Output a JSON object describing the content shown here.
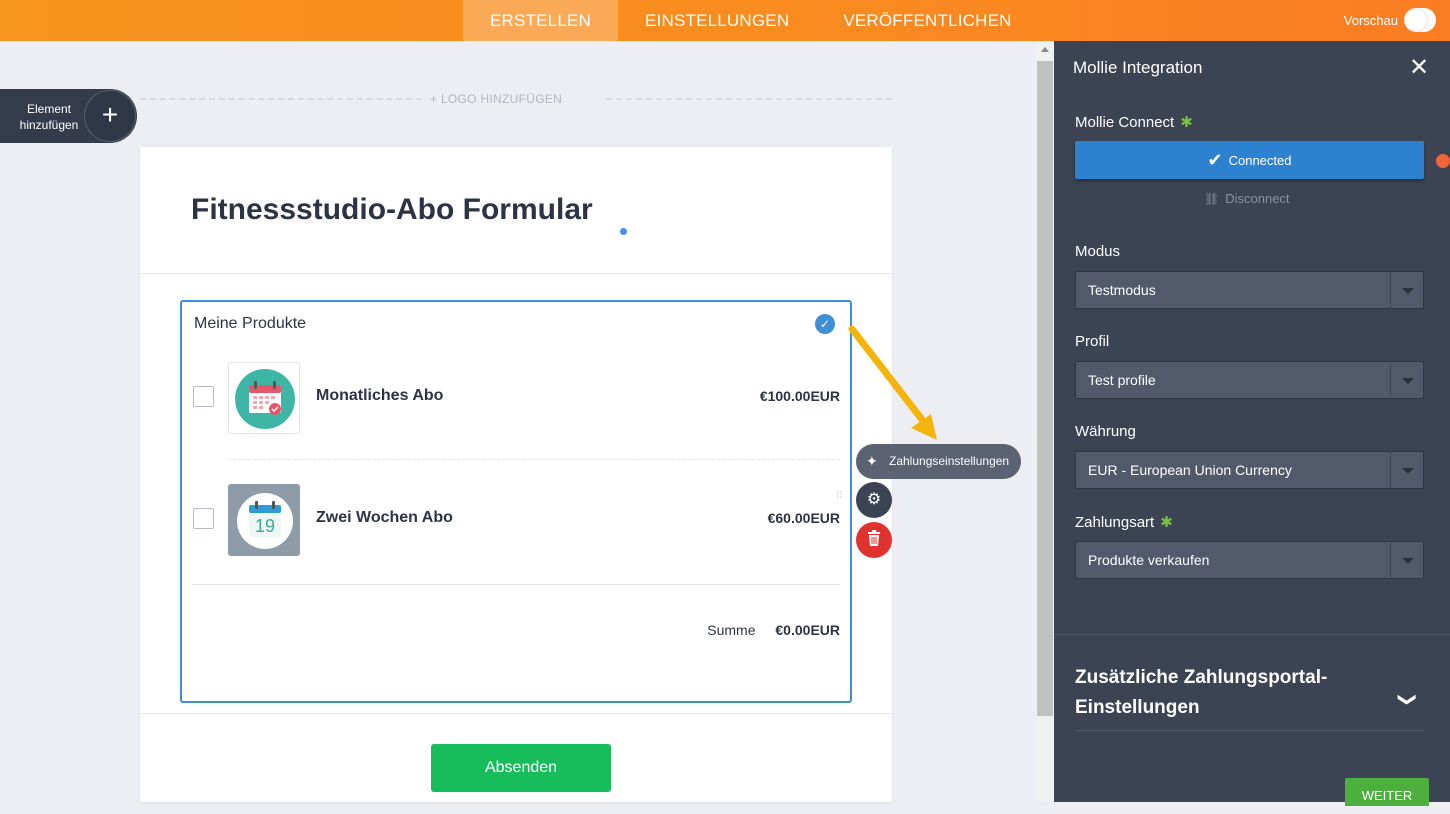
{
  "topbar": {
    "tabs": [
      {
        "label": "ERSTELLEN",
        "active": true
      },
      {
        "label": "EINSTELLUNGEN",
        "active": false
      },
      {
        "label": "VERÖFFENTLICHEN",
        "active": false
      }
    ],
    "preview_label": "Vorschau"
  },
  "builder": {
    "add_element_label": "Element hinzufügen",
    "add_logo_label": "+ LOGO HINZUFÜGEN"
  },
  "form": {
    "title": "Fitnessstudio-Abo Formular",
    "products_label": "Meine Produkte",
    "products": [
      {
        "name": "Monatliches Abo",
        "price": "€100.00",
        "currency": "EUR",
        "icon": "calendar-check-icon"
      },
      {
        "name": "Zwei Wochen Abo",
        "price": "€60.00",
        "currency": "EUR",
        "icon": "calendar-19-icon",
        "day": "19"
      }
    ],
    "sum_label": "Summe",
    "sum_value": "€0.00",
    "sum_currency": "EUR",
    "submit_label": "Absenden"
  },
  "field_actions": {
    "payment_settings_label": "Zahlungseinstellungen"
  },
  "panel": {
    "title": "Mollie Integration",
    "connect_label": "Mollie Connect",
    "connected_label": "Connected",
    "disconnect_label": "Disconnect",
    "mode_label": "Modus",
    "mode_value": "Testmodus",
    "profile_label": "Profil",
    "profile_value": "Test profile",
    "currency_label": "Währung",
    "currency_value": "EUR - European Union Currency",
    "payment_type_label": "Zahlungsart",
    "payment_type_value": "Produkte verkaufen",
    "section_title": "Zusätzliche Zahlungsportal-Einstellungen",
    "next_label": "WEITER"
  },
  "colors": {
    "topbar": "#f98a1f",
    "panel": "#3c4352",
    "accent_blue": "#2c82cf",
    "submit_green": "#18bd5b",
    "delete_red": "#e0322f",
    "required_star": "#7ac143",
    "arrow": "#f5b40c"
  }
}
